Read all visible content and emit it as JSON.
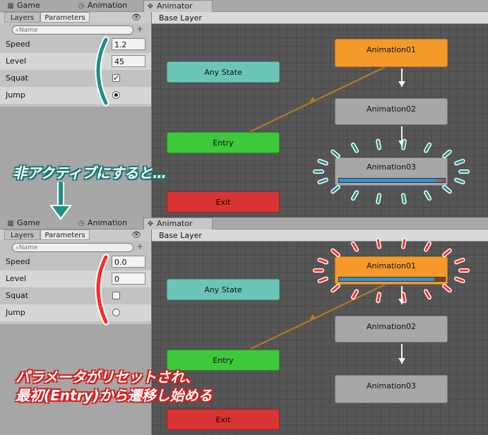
{
  "window_tabs": [
    {
      "label": "Game",
      "icon": "game-icon"
    },
    {
      "label": "Animation",
      "icon": "clock-icon"
    },
    {
      "label": "Animator",
      "icon": "animator-icon",
      "active": true
    }
  ],
  "left_tabs": {
    "layers": "Layers",
    "parameters": "Parameters"
  },
  "search": {
    "placeholder": "Name"
  },
  "panel_top": {
    "params": [
      {
        "name": "Speed",
        "value": "1.2"
      },
      {
        "name": "Level",
        "value": "45"
      },
      {
        "name": "Squat",
        "checked": true
      },
      {
        "name": "Jump",
        "checked": true
      }
    ],
    "layer": "Base Layer",
    "nodes": {
      "any": "Any State",
      "entry": "Entry",
      "exit": "Exit",
      "anim1": "Animation01",
      "anim2": "Animation02",
      "anim3": "Animation03"
    },
    "playing": "Animation03",
    "progress": 0.92
  },
  "panel_bottom": {
    "params": [
      {
        "name": "Speed",
        "value": "0.0"
      },
      {
        "name": "Level",
        "value": "0"
      },
      {
        "name": "Squat",
        "checked": false
      },
      {
        "name": "Jump",
        "checked": false
      }
    ],
    "layer": "Base Layer",
    "nodes": {
      "any": "Any State",
      "entry": "Entry",
      "exit": "Exit",
      "anim1": "Animation01",
      "anim2": "Animation02",
      "anim3": "Animation03"
    },
    "playing": "Animation01",
    "progress": 0.9
  },
  "annotations": {
    "top_caption": "非アクティブにすると…",
    "bottom_caption_line1": "パラメータがリセットされ、",
    "bottom_caption_line2": "最初(Entry)から遷移し始める"
  },
  "colors": {
    "teal_highlight": "#1f8f86",
    "red_highlight": "#ff2a2a",
    "state_orange": "#f59a2a",
    "progress_blue": "#3a8fd6"
  }
}
